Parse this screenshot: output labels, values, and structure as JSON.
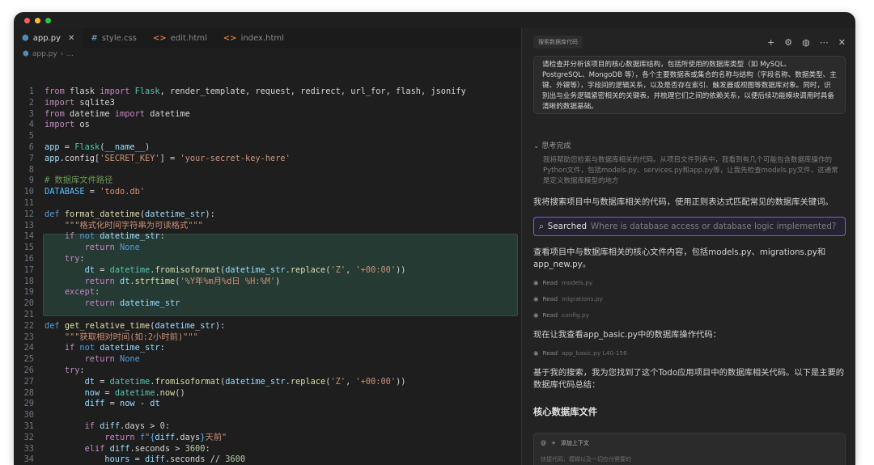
{
  "editor": {
    "tabs": [
      {
        "label": "app.py",
        "icon": "python-icon",
        "active": true
      },
      {
        "label": "style.css",
        "icon": "css-icon",
        "active": false
      },
      {
        "label": "edit.html",
        "icon": "html-icon",
        "active": false
      },
      {
        "label": "index.html",
        "icon": "html-icon",
        "active": false
      }
    ],
    "breadcrumb": {
      "file": "app.py",
      "separator": "›",
      "rest": "..."
    },
    "line_numbers": [
      "1",
      "2",
      "3",
      "4",
      "5",
      "6",
      "7",
      "8",
      "9",
      "10",
      "11",
      "12",
      "13",
      "14",
      "15",
      "16",
      "17",
      "18",
      "19",
      "20",
      "21",
      "22",
      "23",
      "24",
      "25",
      "26",
      "27",
      "28",
      "29",
      "30",
      "31",
      "32",
      "33",
      "34"
    ],
    "highlight_lines": [
      14,
      20
    ]
  },
  "chat": {
    "tab_label": "搜索数据库代码",
    "prompt": "请检查并分析该项目的核心数据库结构，包括所使用的数据库类型（如 MySQL、PostgreSQL、MongoDB 等），各个主要数据表或集合的名称与结构（字段名称、数据类型、主键、外键等），字段间的逻辑关系，以及是否存在索引、触发器或视图等数据库对象。同时，识别出与业务逻辑紧密相关的关键表，并梳理它们之间的依赖关系，以便后续功能模块调用时具备清晰的数据基础。",
    "thinking_header": "思考完成",
    "thinking_text": "我将帮助您检索与数据库相关的代码。从项目文件列表中，我看到有几个可能包含数据库操作的Python文件，包括models.py、services.py和app.py等，让我先检查models.py文件，这通常是定义数据库模型的地方",
    "para1": "我将搜索项目中与数据库相关的代码，使用正则表达式匹配常见的数据库关键词。",
    "searched_label": "Searched",
    "searched_query": "Where is database access or database logic implemented?",
    "para2": "查看项目中与数据库相关的核心文件内容，包括models.py、migrations.py和app_new.py。",
    "read_label": "Read",
    "reads": [
      "models.py",
      "migrations.py",
      "config.py"
    ],
    "para3": "现在让我查看app_basic.py中的数据库操作代码：",
    "read4": "app_basic.py L40-156",
    "para4": "基于我的搜索，我为您找到了这个Todo应用项目中的数据库相关代码。以下是主要的数据库代码总结：",
    "section_title": "核心数据库文件",
    "add_context": "添加上下文",
    "input_placeholder": "快捷代码，模糊以及一切应付需要的"
  }
}
